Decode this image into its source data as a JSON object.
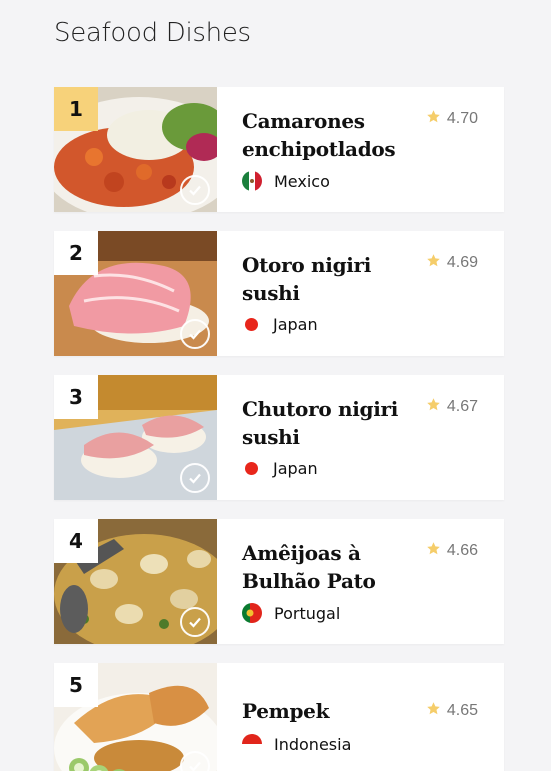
{
  "page": {
    "title": "Seafood Dishes"
  },
  "colors": {
    "rank_highlight": "#f7d27a",
    "star": "#f5cd6a",
    "japan_red": "#e8261b"
  },
  "dishes": [
    {
      "rank": "1",
      "name": "Camarones enchipotlados",
      "rating": "4.70",
      "country": "Mexico",
      "flag": "mexico-flag-icon",
      "photo": "camarones-photo"
    },
    {
      "rank": "2",
      "name": "Otoro nigiri sushi",
      "rating": "4.69",
      "country": "Japan",
      "flag": "japan-dot-icon",
      "photo": "otoro-photo"
    },
    {
      "rank": "3",
      "name": "Chutoro nigiri sushi",
      "rating": "4.67",
      "country": "Japan",
      "flag": "japan-dot-icon",
      "photo": "chutoro-photo"
    },
    {
      "rank": "4",
      "name": "Amêijoas à Bulhão Pato",
      "rating": "4.66",
      "country": "Portugal",
      "flag": "portugal-flag-icon",
      "photo": "ameijoas-photo"
    },
    {
      "rank": "5",
      "name": "Pempek",
      "rating": "4.65",
      "country": "Indonesia",
      "flag": "indonesia-flag-icon",
      "photo": "pempek-photo"
    }
  ]
}
